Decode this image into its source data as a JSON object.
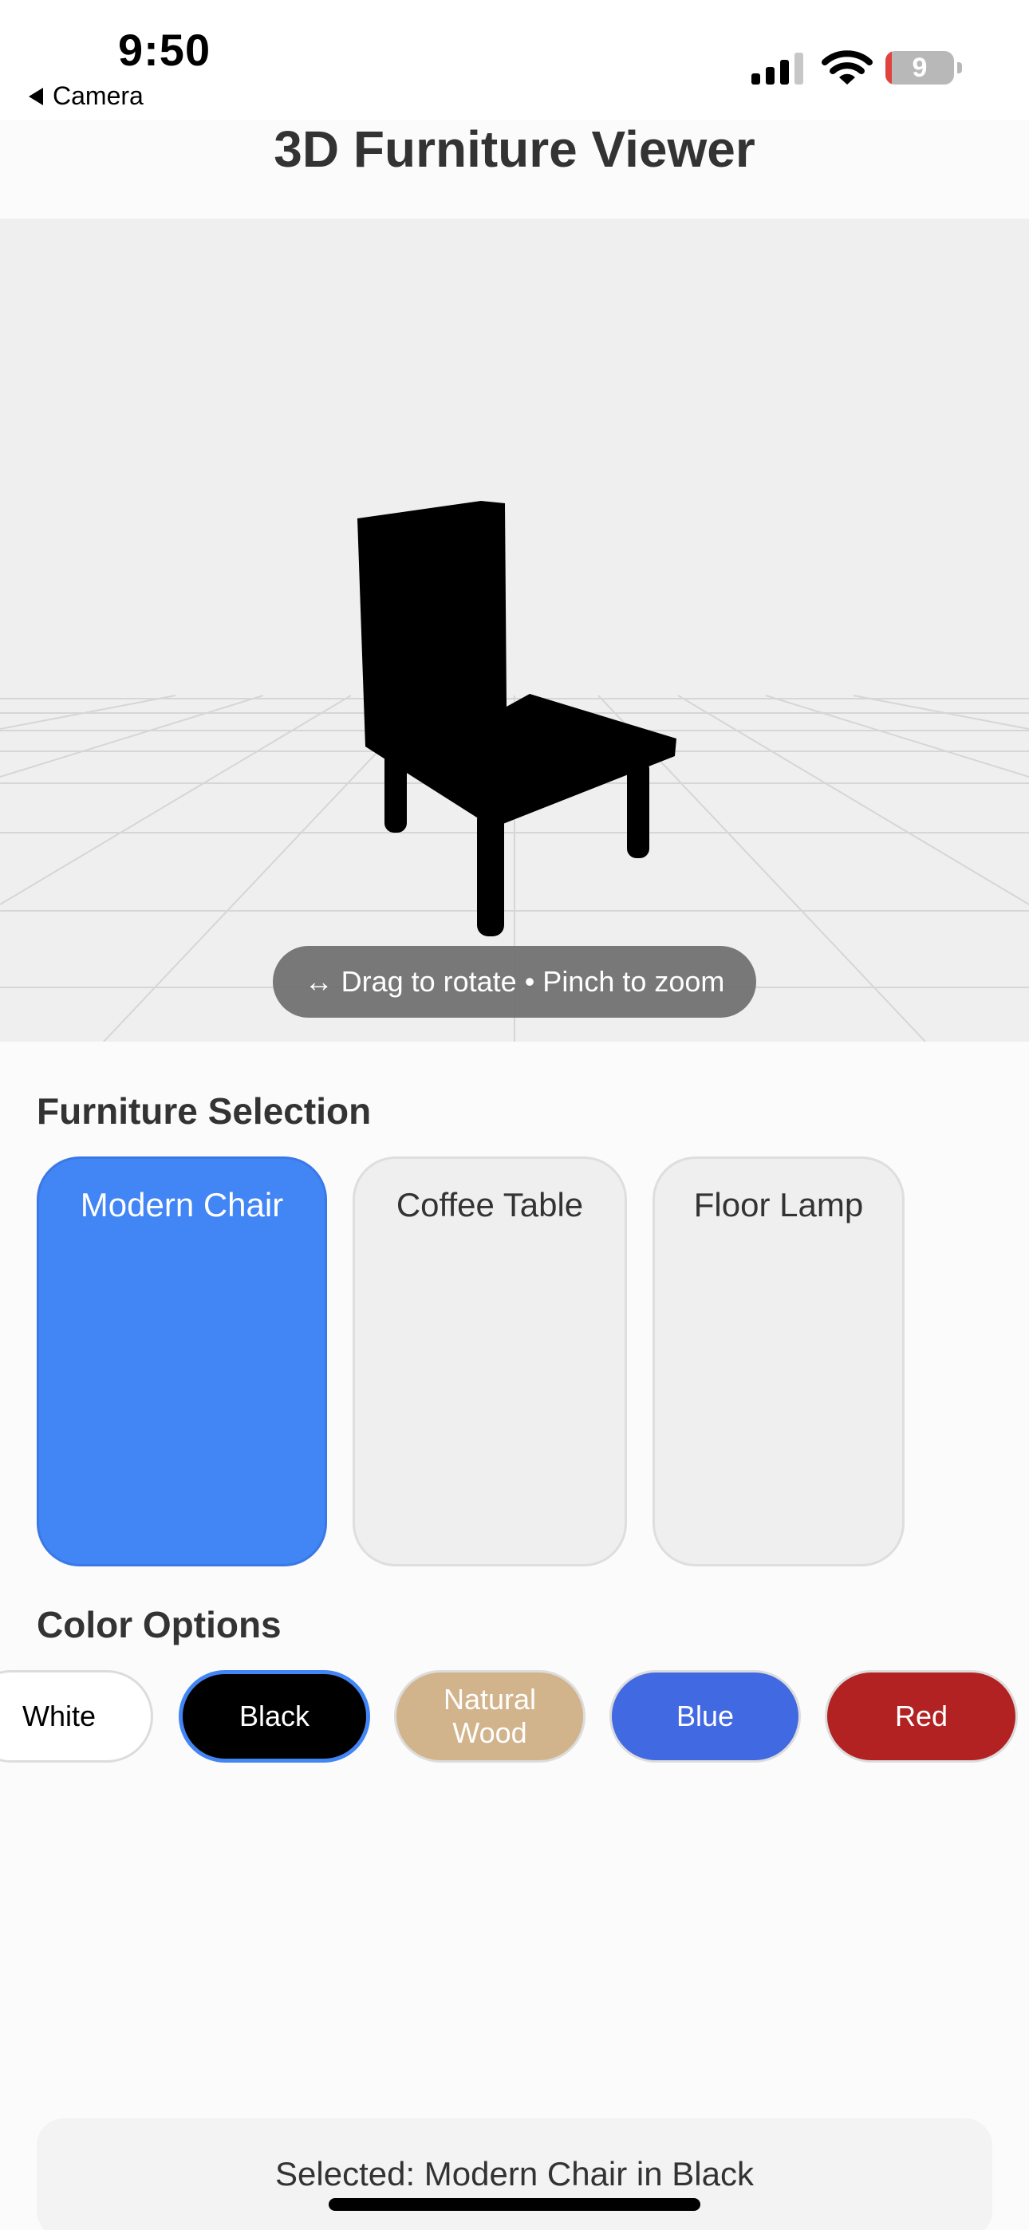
{
  "status_bar": {
    "time": "9:50",
    "back_label": "Camera",
    "battery_level": "9",
    "battery_fraction": 0.09
  },
  "page_title": "3D Furniture Viewer",
  "viewer": {
    "hint": "↔ Drag to rotate • Pinch to zoom",
    "model_color": "#000000",
    "background": "#efefef"
  },
  "furniture": {
    "section_title": "Furniture Selection",
    "items": [
      {
        "label": "Modern Chair",
        "selected": true
      },
      {
        "label": "Coffee Table",
        "selected": false
      },
      {
        "label": "Floor Lamp",
        "selected": false
      }
    ]
  },
  "colors": {
    "section_title": "Color Options",
    "options": [
      {
        "label": "White",
        "bg": "#ffffff",
        "fg": "#000000",
        "selected": false
      },
      {
        "label": "Black",
        "bg": "#000000",
        "fg": "#ffffff",
        "selected": true
      },
      {
        "label": "Natural\nWood",
        "bg": "#d2b48c",
        "fg": "#ffffff",
        "selected": false
      },
      {
        "label": "Blue",
        "bg": "#4169e1",
        "fg": "#ffffff",
        "selected": false
      },
      {
        "label": "Red",
        "bg": "#b22222",
        "fg": "#ffffff",
        "selected": false
      }
    ]
  },
  "selection_status": "Selected: Modern Chair in Black",
  "accent_color": "#4285f4"
}
